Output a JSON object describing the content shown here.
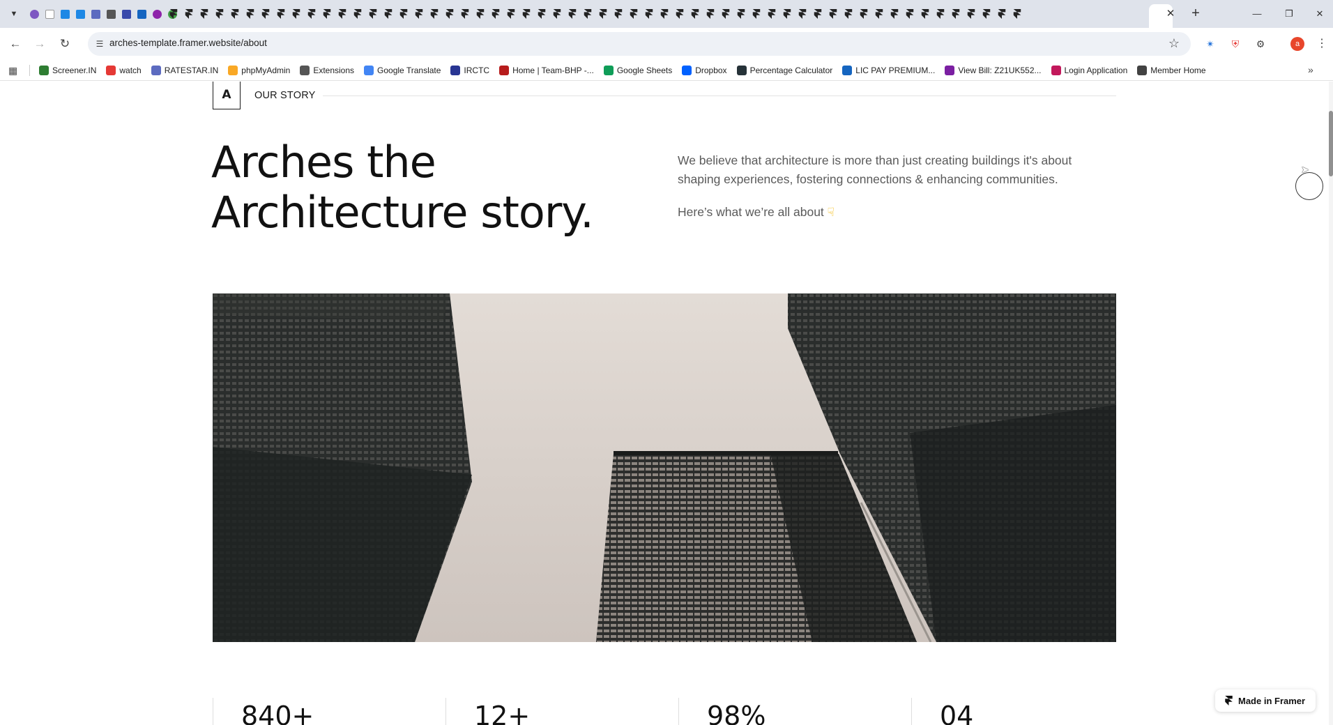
{
  "browser": {
    "url": "arches-template.framer.website/about",
    "bookmarks": [
      {
        "label": "Screener.IN",
        "color": "#2e7d32"
      },
      {
        "label": "watch",
        "color": "#e53935"
      },
      {
        "label": "RATESTAR.IN",
        "color": "#5c6bc0"
      },
      {
        "label": "phpMyAdmin",
        "color": "#f9a825"
      },
      {
        "label": "Extensions",
        "color": "#555555"
      },
      {
        "label": "Google Translate",
        "color": "#4285f4"
      },
      {
        "label": "IRCTC",
        "color": "#283593"
      },
      {
        "label": "Home | Team-BHP -...",
        "color": "#b71c1c"
      },
      {
        "label": "Google Sheets",
        "color": "#0f9d58"
      },
      {
        "label": "Dropbox",
        "color": "#0061ff"
      },
      {
        "label": "Percentage Calculator",
        "color": "#263238"
      },
      {
        "label": "LIC PAY PREMIUM...",
        "color": "#1565c0"
      },
      {
        "label": "View Bill: Z21UK552...",
        "color": "#7b1fa2"
      },
      {
        "label": "Login Application",
        "color": "#c2185b"
      },
      {
        "label": "Member Home",
        "color": "#424242"
      }
    ]
  },
  "page": {
    "logo_letter": "A",
    "section_label": "OUR STORY",
    "headline_line1": "Arches the",
    "headline_line2": "Architecture story.",
    "intro_text": "We believe that architecture is more than just creating buildings it's about shaping experiences, fostering connections & enhancing communities.",
    "intro_followup": "Here’s what we’re all about",
    "hero_image": "skyscrapers-looking-up",
    "stats": [
      "840+",
      "12+",
      "98%",
      "04"
    ],
    "badge_label": "Made in Framer"
  }
}
